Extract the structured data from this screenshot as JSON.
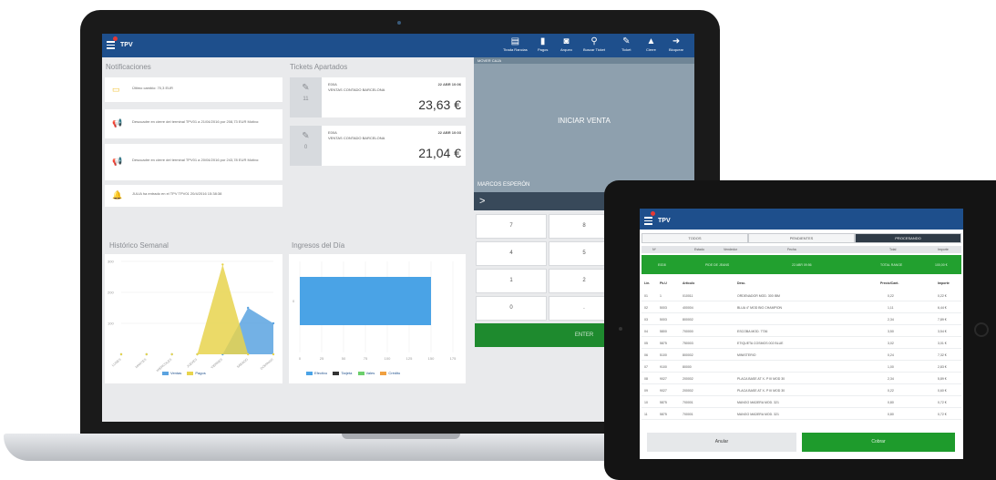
{
  "app": {
    "title": "TPV"
  },
  "toolbar": [
    {
      "icon": "cash-register-icon",
      "glyph": "▤",
      "label": "Tirada Rancias"
    },
    {
      "icon": "payments-icon",
      "glyph": "▮",
      "label": "Pagos"
    },
    {
      "icon": "adjust-icon",
      "glyph": "◙",
      "label": "Arqueo"
    },
    {
      "icon": "search-icon",
      "glyph": "⚲",
      "label": "Buscar Ticket"
    },
    {
      "icon": "ticket-icon",
      "glyph": "✎",
      "label": "Ticket"
    },
    {
      "icon": "lock-icon",
      "glyph": "▲",
      "label": "Cierre"
    },
    {
      "icon": "logout-icon",
      "glyph": "➜",
      "label": "Bloquear"
    }
  ],
  "notifications": {
    "title": "Notificaciones",
    "items": [
      {
        "icon": "money-icon",
        "glyph": "▭",
        "color": "#f1c232",
        "text": "Último cambio: 70,3 EUR"
      },
      {
        "icon": "megaphone-icon",
        "glyph": "📢",
        "color": "#d32f2f",
        "text": "Descuadre en cierre del terminal TPV01 a 21/04/2016 por 208,73 EUR Motivo:"
      },
      {
        "icon": "megaphone-icon",
        "glyph": "📢",
        "color": "#d32f2f",
        "text": "Descuadre en cierre del terminal TPV01 a 20/04/2016 por 243,78 EUR Motivo:"
      },
      {
        "icon": "bell-icon",
        "glyph": "🔔",
        "color": "#1e4f8c",
        "text": "JULIA ha entrado en el TPV TPV01 20/4/2016 15:38:38"
      }
    ]
  },
  "tickets": {
    "title": "Tickets Apartados",
    "items": [
      {
        "number": "11",
        "code": "E00A",
        "desc": "VENTAS CONTADO BARCELONA",
        "date": "22 ABR 10:06",
        "amount": "23,63 €"
      },
      {
        "number": "0",
        "code": "E00A",
        "desc": "VENTAS CONTADO BARCELONA",
        "date": "22 ABR 10:03",
        "amount": "21,04 €"
      }
    ]
  },
  "weekly": {
    "title": "Histórico Semanal",
    "legend": [
      "Ventas",
      "Pagos"
    ]
  },
  "daily": {
    "title": "Ingresos del Día",
    "legend": [
      "Efectivo",
      "Tarjeta",
      "Vales",
      "Crédito"
    ]
  },
  "chart_data": [
    {
      "type": "area",
      "title": "Histórico Semanal",
      "categories": [
        "LUNES",
        "MARTES",
        "MIERCOLES",
        "JUEVES",
        "VIERNES",
        "SÁBADO",
        "DOMINGO"
      ],
      "series": [
        {
          "name": "Ventas",
          "color": "#5ba3e0",
          "values": [
            0,
            0,
            0,
            0,
            0,
            150,
            100
          ]
        },
        {
          "name": "Pagos",
          "color": "#e8d44d",
          "values": [
            0,
            0,
            0,
            0,
            290,
            0,
            0
          ]
        }
      ],
      "yticks": [
        "300",
        "200",
        "100"
      ],
      "ylim": [
        0,
        300
      ]
    },
    {
      "type": "bar",
      "title": "Ingresos del Día",
      "orientation": "horizontal",
      "categories": [
        "0"
      ],
      "series": [
        {
          "name": "Efectivo",
          "color": "#4aa3e6",
          "values": [
            150
          ]
        },
        {
          "name": "Tarjeta",
          "color": "#333333",
          "values": [
            0
          ]
        },
        {
          "name": "Vales",
          "color": "#6ccf6c",
          "values": [
            0
          ]
        },
        {
          "name": "Crédito",
          "color": "#f0a040",
          "values": [
            0
          ]
        }
      ],
      "xticks": [
        "0",
        "25",
        "50",
        "75",
        "100",
        "125",
        "150",
        "175"
      ],
      "xlim": [
        0,
        175
      ]
    }
  ],
  "pos": {
    "header": "MOVER CAJA",
    "start_sale": "INICIAR VENTA",
    "cashier": "MARCOS ESPERÓN",
    "arrow": ">",
    "keys": [
      "7",
      "8",
      "4",
      "5",
      "1",
      "2",
      "0",
      "."
    ],
    "enter": "ENTER"
  },
  "tablet": {
    "title": "TPV",
    "tabs": [
      "TODOS",
      "PENDIENTES",
      "PROCESANDO"
    ],
    "header_cols": [
      "Nº",
      "Estado",
      "Vendedor",
      "Fecha",
      "Total",
      "Importe"
    ],
    "green_row": [
      "E0D8",
      "PIDE DE JEANS",
      "22 ABR 09:56",
      "TOTAL RANGE",
      "100,00 €"
    ],
    "lines_cols": [
      "Lín.",
      "Pk.U",
      "Artículo",
      "Desc.",
      "Precio/Cant.",
      "Importe"
    ],
    "lines": [
      {
        "lin": "01",
        "pk": "1",
        "art": "010011",
        "desc": "ORDENADOR MOD. 300 IBM",
        "price": "0,22",
        "total": "0,22 €"
      },
      {
        "lin": "02",
        "pk": "5003",
        "art": "400004",
        "desc": "BLUA 4\" MOD BIG CHAMPION",
        "price": "1,11",
        "total": "6,44 €"
      },
      {
        "lin": "03",
        "pk": "5003",
        "art": "800002",
        "desc": "",
        "price": "2,34",
        "total": "7,89 €"
      },
      {
        "lin": "04",
        "pk": "5800",
        "art": "700000",
        "desc": "ESCOBA MOD. 7736",
        "price": "3,50",
        "total": "3,54 €"
      },
      {
        "lin": "05",
        "pk": "5875",
        "art": "750003",
        "desc": "ETIQUETA COSMOS 002 BLUE",
        "price": "3,02",
        "total": "3,01 €"
      },
      {
        "lin": "06",
        "pk": "5100",
        "art": "800002",
        "desc": "MINISTERIO",
        "price": "0,24",
        "total": "7,32 €"
      },
      {
        "lin": "07",
        "pk": "9100",
        "art": "80000",
        "desc": "",
        "price": "1,00",
        "total": "2,83 €"
      },
      {
        "lin": "08",
        "pk": "9027",
        "art": "200002",
        "desc": "PLACA BASE AT X- P III MOD 30",
        "price": "2,34",
        "total": "5,89 €"
      },
      {
        "lin": "09",
        "pk": "9027",
        "art": "200002",
        "desc": "PLACA BASE AT X- P III MOD 30",
        "price": "0,22",
        "total": "0,60 €"
      },
      {
        "lin": "10",
        "pk": "5875",
        "art": "700001",
        "desc": "MANGO MADERA MOD. 321",
        "price": "0,80",
        "total": "0,72 €"
      },
      {
        "lin": "11",
        "pk": "5875",
        "art": "700001",
        "desc": "MANGO MADERA MOD. 321",
        "price": "0,80",
        "total": "0,72 €"
      }
    ],
    "cancel": "Anular",
    "checkout": "Cobrar"
  }
}
